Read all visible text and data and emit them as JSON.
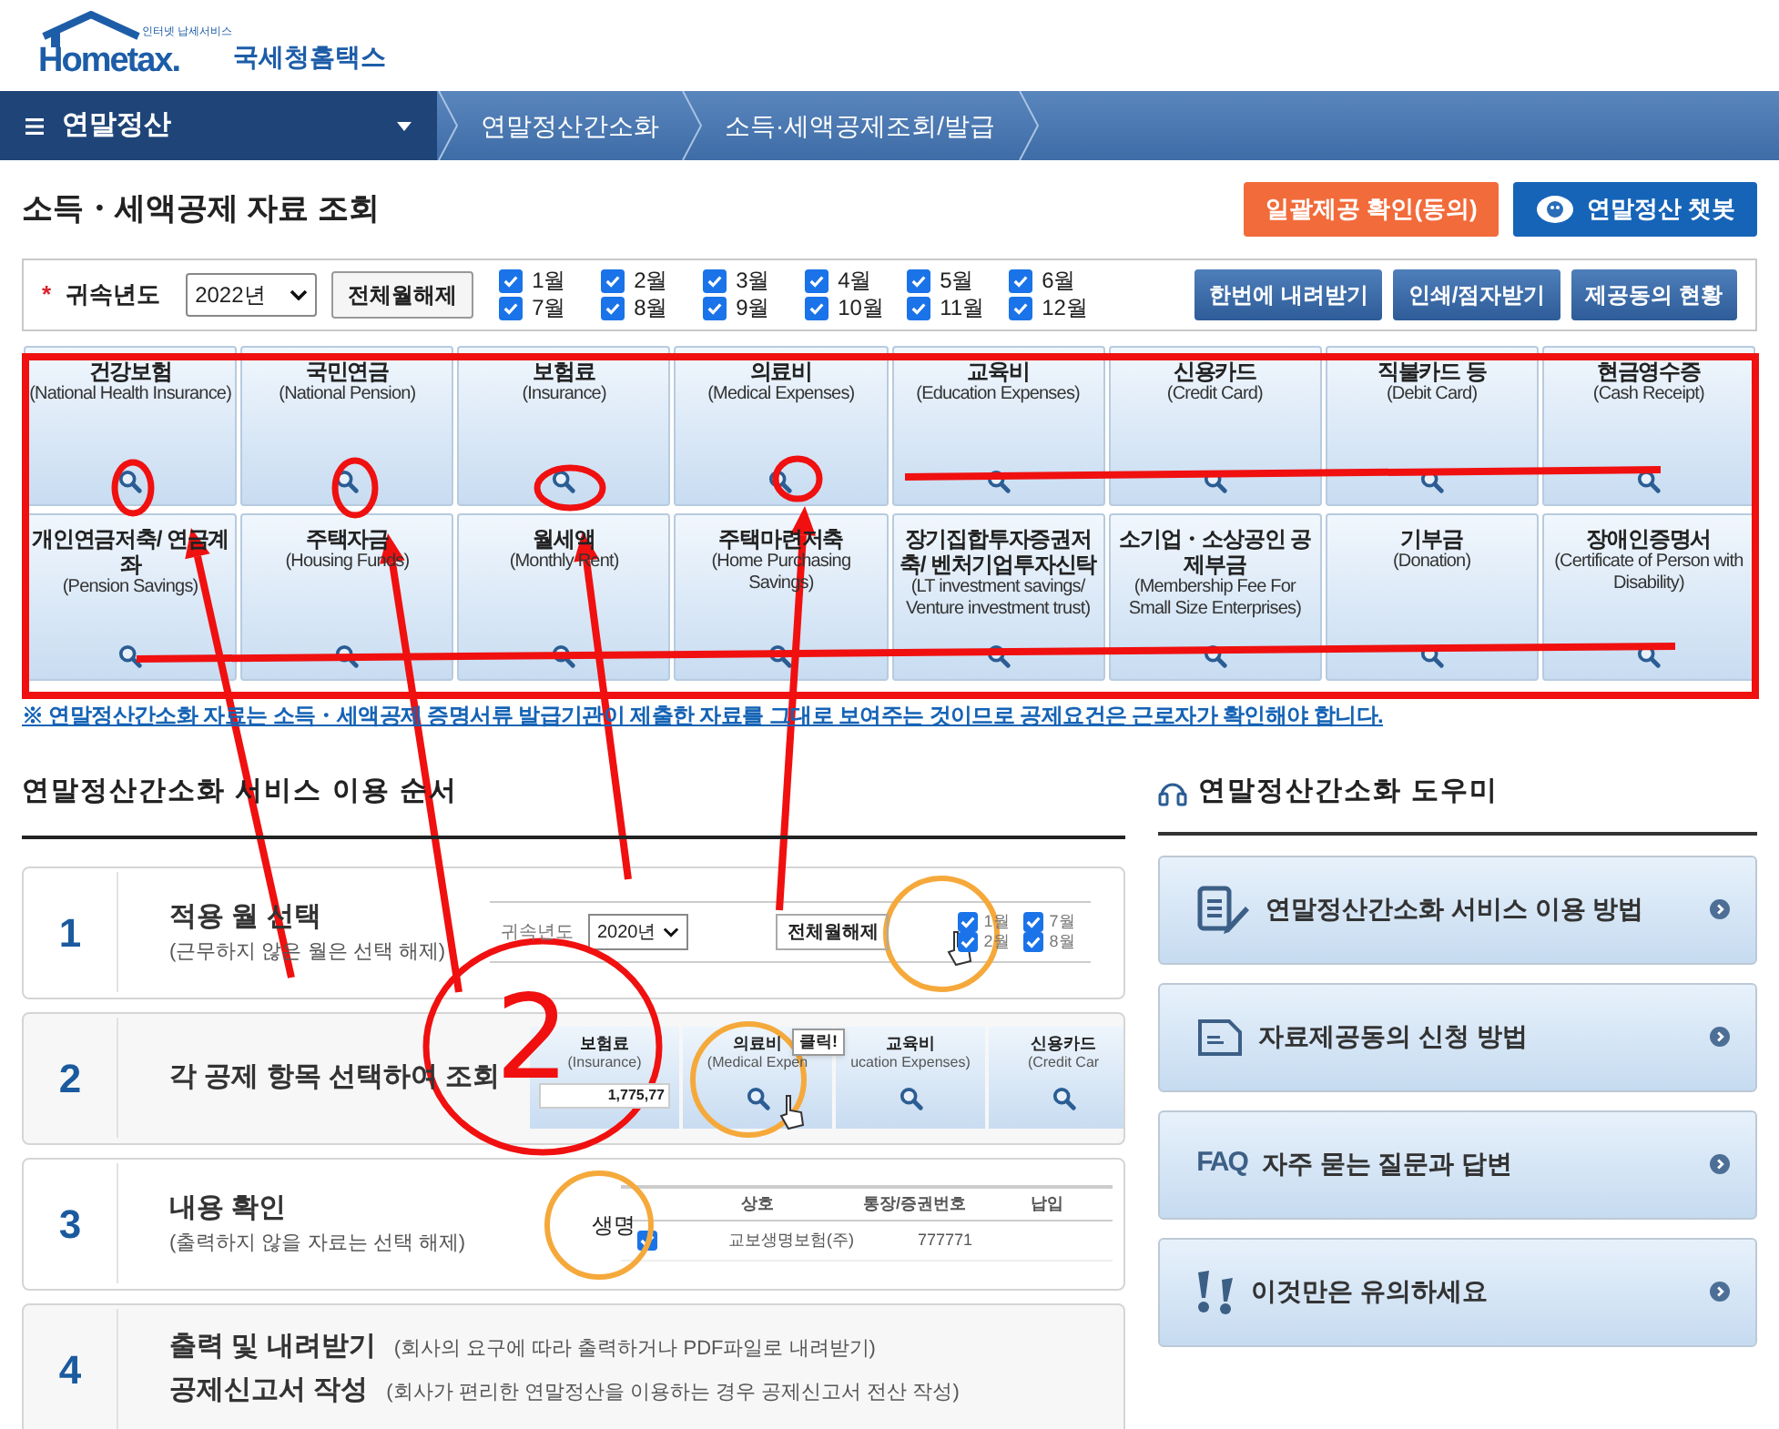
{
  "logo": {
    "tagline": "인터넷 납세서비스",
    "wordmark": "Hometax.",
    "name": "국세청홈택스"
  },
  "nav": {
    "menu": "연말정산",
    "breadcrumbs": [
      "연말정산간소화",
      "소득·세액공제조회/발급"
    ]
  },
  "page_title": "소득・세액공제 자료 조회",
  "header_buttons": [
    {
      "label": "일괄제공 확인(동의)",
      "kind": "consent"
    },
    {
      "label": "연말정산 챗봇",
      "kind": "chatbot"
    }
  ],
  "filter": {
    "required_mark": "*",
    "label": "귀속년도",
    "year": "2022년",
    "clear_button": "전체월해제",
    "months": [
      {
        "label": "1월",
        "checked": true
      },
      {
        "label": "2월",
        "checked": true
      },
      {
        "label": "3월",
        "checked": true
      },
      {
        "label": "4월",
        "checked": true
      },
      {
        "label": "5월",
        "checked": true
      },
      {
        "label": "6월",
        "checked": true
      },
      {
        "label": "7월",
        "checked": true
      },
      {
        "label": "8월",
        "checked": true
      },
      {
        "label": "9월",
        "checked": true
      },
      {
        "label": "10월",
        "checked": true
      },
      {
        "label": "11월",
        "checked": true
      },
      {
        "label": "12월",
        "checked": true
      }
    ],
    "actions": [
      "한번에 내려받기",
      "인쇄/점자받기",
      "제공동의 현황"
    ]
  },
  "categories": [
    {
      "title": "건강보험",
      "subtitle": "(National Health Insurance)"
    },
    {
      "title": "국민연금",
      "subtitle": "(National Pension)"
    },
    {
      "title": "보험료",
      "subtitle": "(Insurance)"
    },
    {
      "title": "의료비",
      "subtitle": "(Medical Expenses)"
    },
    {
      "title": "교육비",
      "subtitle": "(Education Expenses)"
    },
    {
      "title": "신용카드",
      "subtitle": "(Credit Card)"
    },
    {
      "title": "직불카드 등",
      "subtitle": "(Debit Card)"
    },
    {
      "title": "현금영수증",
      "subtitle": "(Cash Receipt)"
    },
    {
      "title": "개인연금저축/ 연금계좌",
      "subtitle": "(Pension Savings)"
    },
    {
      "title": "주택자금",
      "subtitle": "(Housing Funds)"
    },
    {
      "title": "월세액",
      "subtitle": "(Monthly Rent)"
    },
    {
      "title": "주택마련저축",
      "subtitle": "(Home Purchasing Savings)"
    },
    {
      "title": "장기집합투자증권저축/ 벤처기업투자신탁",
      "subtitle": "(LT investment savings/ Venture investment trust)"
    },
    {
      "title": "소기업・소상공인 공제부금",
      "subtitle": "(Membership Fee For Small Size Enterprises)"
    },
    {
      "title": "기부금",
      "subtitle": "(Donation)"
    },
    {
      "title": "장애인증명서",
      "subtitle": "(Certificate of Person with Disability)"
    }
  ],
  "notice": "※ 연말정산간소화 자료는 소득・세액공제 증명서류 발급기관이 제출한 자료를 그대로 보여주는 것이므로 공제요건은 근로자가 확인해야 합니다.",
  "guide": {
    "title": "연말정산간소화 서비스 이용 순서",
    "steps": [
      {
        "number": "1",
        "kind": "months",
        "lines": [
          {
            "title": "적용 월 선택",
            "note": "(근무하지 않은 월은 선택 해제)"
          }
        ],
        "example": {
          "label": "귀속년도",
          "year": "2020년",
          "button": "전체월해제",
          "months": [
            {
              "label": "1월",
              "checked": true
            },
            {
              "label": "2월",
              "checked": true
            },
            {
              "label": "7월",
              "checked": true
            },
            {
              "label": "8월",
              "checked": true
            }
          ]
        }
      },
      {
        "number": "2",
        "kind": "tiles",
        "lines": [
          {
            "title": "각 공제 항목 선택하여 조회"
          }
        ],
        "example": {
          "tiles": [
            {
              "title": "보험료",
              "subtitle": "(Insurance)",
              "amount": "1,775,77"
            },
            {
              "title": "의료비",
              "subtitle": "(Medical Expen"
            },
            {
              "title": "교육비",
              "subtitle": "ucation Expenses)"
            },
            {
              "title": "신용카드",
              "subtitle": "(Credit Car"
            }
          ],
          "tooltip": "클릭!"
        }
      },
      {
        "number": "3",
        "kind": "table",
        "lines": [
          {
            "title": "내용 확인",
            "note": "(출력하지 않을 자료는 선택 해제)"
          }
        ],
        "example": {
          "columns": [
            "상호",
            "통장/증권번호",
            "납입"
          ],
          "magnified": "생명",
          "rows": [
            {
              "checked": true,
              "cells": [
                "교보생명보험(주)",
                "777771"
              ]
            }
          ]
        }
      },
      {
        "number": "4",
        "kind": "text",
        "lines": [
          {
            "title": "출력 및 내려받기",
            "note": "(회사의 요구에 따라 출력하거나 PDF파일로 내려받기)"
          },
          {
            "title": "공제신고서 작성",
            "note": "(회사가 편리한 연말정산을 이용하는 경우 공제신고서 전산 작성)"
          }
        ]
      }
    ]
  },
  "helper": {
    "title": "연말정산간소화 도우미",
    "items": [
      {
        "label": "연말정산간소화 서비스 이용 방법",
        "kind": "manual"
      },
      {
        "label": "자료제공동의 신청 방법",
        "kind": "document"
      },
      {
        "label": "자주 묻는 질문과 답변",
        "kind": "faq",
        "badge": "FAQ"
      },
      {
        "label": "이것만은 유의하세요",
        "kind": "warning"
      }
    ]
  },
  "annotation": {
    "label": "2"
  }
}
